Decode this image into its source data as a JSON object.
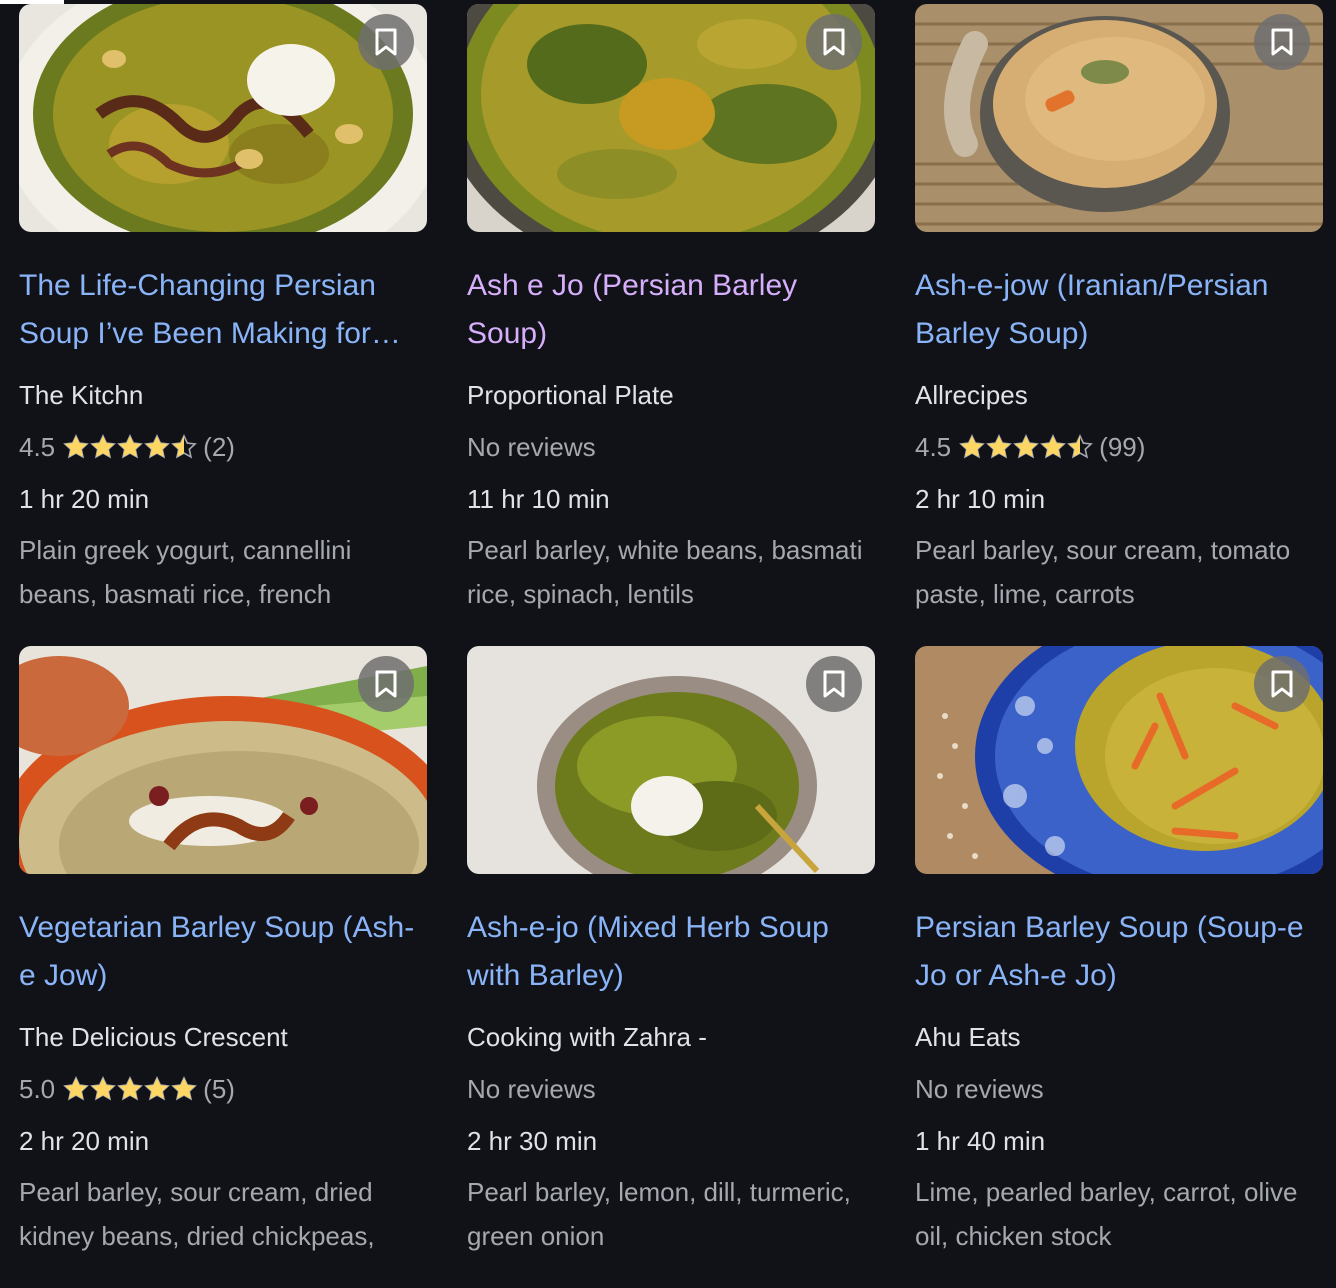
{
  "cards": [
    {
      "title": "The Life-Changing Persian Soup I’ve Been Making for…",
      "visited": false,
      "source": "The Kitchn",
      "rating_value": "4.5",
      "rating_stars": 4.5,
      "review_count": "(2)",
      "time": "1 hr 20 min",
      "ingredients": "Plain greek yogurt, cannellini beans, basmati rice, french"
    },
    {
      "title": "Ash e Jo (Persian Barley Soup)",
      "visited": true,
      "source": "Proportional Plate",
      "rating_text": "No reviews",
      "time": "11 hr 10 min",
      "ingredients": "Pearl barley, white beans, basmati rice, spinach, lentils"
    },
    {
      "title": "Ash-e-jow (Iranian/Persian Barley Soup)",
      "visited": false,
      "source": "Allrecipes",
      "rating_value": "4.5",
      "rating_stars": 4.5,
      "review_count": "(99)",
      "time": "2 hr 10 min",
      "ingredients": "Pearl barley, sour cream, tomato paste, lime, carrots"
    },
    {
      "title": "Vegetarian Barley Soup (Ash-e Jow)",
      "visited": false,
      "source": "The Delicious Crescent",
      "rating_value": "5.0",
      "rating_stars": 5,
      "review_count": "(5)",
      "time": "2 hr 20 min",
      "ingredients": "Pearl barley, sour cream, dried kidney beans, dried chickpeas,"
    },
    {
      "title": "Ash-e-jo (Mixed Herb Soup with Barley)",
      "visited": false,
      "source": "Cooking with Zahra -",
      "rating_text": "No reviews",
      "time": "2 hr 30 min",
      "ingredients": "Pearl barley, lemon, dill, turmeric, green onion"
    },
    {
      "title": "Persian Barley Soup (Soup-e Jo or Ash-e Jo)",
      "visited": false,
      "source": "Ahu Eats",
      "rating_text": "No reviews",
      "time": "1 hr 40 min",
      "ingredients": "Lime, pearled barley, carrot, olive oil, chicken stock"
    }
  ],
  "colors": {
    "background": "#101218",
    "link": "#8ab4f8",
    "visited_link": "#d7aefb",
    "star": "#fdd663",
    "secondary_text": "#a5a8ae",
    "primary_text": "#dfe2e6"
  },
  "icons": {
    "bookmark": "bookmark-icon",
    "star": "star-icon"
  }
}
